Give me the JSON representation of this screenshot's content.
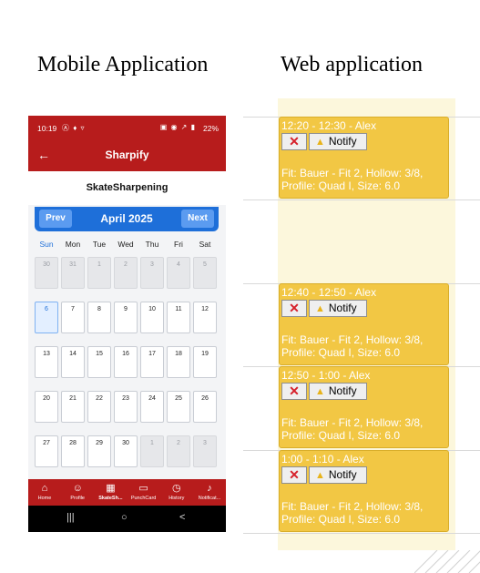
{
  "headings": {
    "mobile": "Mobile Application",
    "web": "Web application"
  },
  "statusbar": {
    "time": "10:19",
    "icons_left": "Ⓐ ♦ ▿",
    "icons_right": "▣ ◉ ↗ ▮",
    "battery": "22%"
  },
  "appbar": {
    "back_icon": "←",
    "title": "Sharpify"
  },
  "page_subtitle": "SkateSharpening",
  "calendar": {
    "prev_label": "Prev",
    "next_label": "Next",
    "month": "April 2025",
    "weekdays": [
      "Sun",
      "Mon",
      "Tue",
      "Wed",
      "Thu",
      "Fri",
      "Sat"
    ],
    "weeks": [
      [
        "30",
        "31",
        "1",
        "2",
        "3",
        "4",
        "5"
      ],
      [
        "6",
        "7",
        "8",
        "9",
        "10",
        "11",
        "12"
      ],
      [
        "13",
        "14",
        "15",
        "16",
        "17",
        "18",
        "19"
      ],
      [
        "20",
        "21",
        "22",
        "23",
        "24",
        "25",
        "26"
      ],
      [
        "27",
        "28",
        "29",
        "30",
        "1",
        "2",
        "3"
      ]
    ],
    "today": "6",
    "accent_color": "#1e6fd9"
  },
  "tabbar": {
    "color": "#b71c1c",
    "items": [
      {
        "label": "Home",
        "icon": "home-icon"
      },
      {
        "label": "Profile",
        "icon": "person-icon"
      },
      {
        "label": "SkateSh...",
        "icon": "calendar-icon",
        "active": true
      },
      {
        "label": "PunchCard",
        "icon": "card-icon"
      },
      {
        "label": "History",
        "icon": "clock-icon"
      },
      {
        "label": "Notificat...",
        "icon": "bell-icon"
      }
    ]
  },
  "system_nav": {
    "recents": "|||",
    "home": "○",
    "back": "<"
  },
  "web": {
    "slot_color": "#f2c744",
    "cancel_icon": "✕",
    "notify_label": "Notify",
    "bookings": [
      {
        "title": "12:20 - 12:30 - Alex",
        "details": "Fit: Bauer - Fit 2, Hollow: 3/8, Profile: Quad I, Size: 6.0"
      },
      {
        "title": "12:40 - 12:50 - Alex",
        "details": "Fit: Bauer - Fit 2, Hollow: 3/8, Profile: Quad I, Size: 6.0"
      },
      {
        "title": "12:50 - 1:00 - Alex",
        "details": "Fit: Bauer - Fit 2, Hollow: 3/8, Profile: Quad I, Size: 6.0"
      },
      {
        "title": "1:00 - 1:10 - Alex",
        "details": "Fit: Bauer - Fit 2, Hollow: 3/8, Profile: Quad I, Size: 6.0"
      }
    ]
  }
}
